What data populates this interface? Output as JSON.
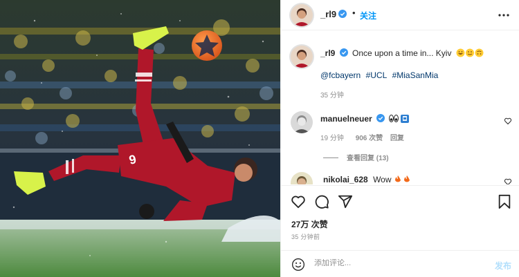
{
  "post": {
    "author": "_rl9",
    "follow_dot": "•",
    "follow_label": "关注",
    "caption": {
      "user": "_rl9",
      "text": "Once upon a time in... Kyiv",
      "emojis": [
        "grinning-face",
        "slightly-smiling-face",
        "upside-down-face"
      ],
      "hashtags": [
        "@fcbayern",
        "#UCL",
        "#MiaSanMia"
      ],
      "time": "35 分钟"
    },
    "comments": [
      {
        "user": "manuelneuer",
        "text": "",
        "emojis": [
          "eyes",
          "bavaria-flag"
        ],
        "time": "19 分钟",
        "likes": "906 次赞",
        "reply_label": "回复",
        "view_replies": "查看回复 (13)"
      },
      {
        "user": "nikolai_628",
        "text": "Wow",
        "emojis": [
          "fire",
          "fire"
        ]
      }
    ],
    "likes_count": "27万 次赞",
    "posted_time": "35 分钟前"
  },
  "composer": {
    "placeholder": "添加评论...",
    "post_label": "发布"
  },
  "colors": {
    "accent": "#0095f6",
    "link": "#00376b",
    "verified": "#3897f0",
    "jersey": "#b0172a"
  }
}
